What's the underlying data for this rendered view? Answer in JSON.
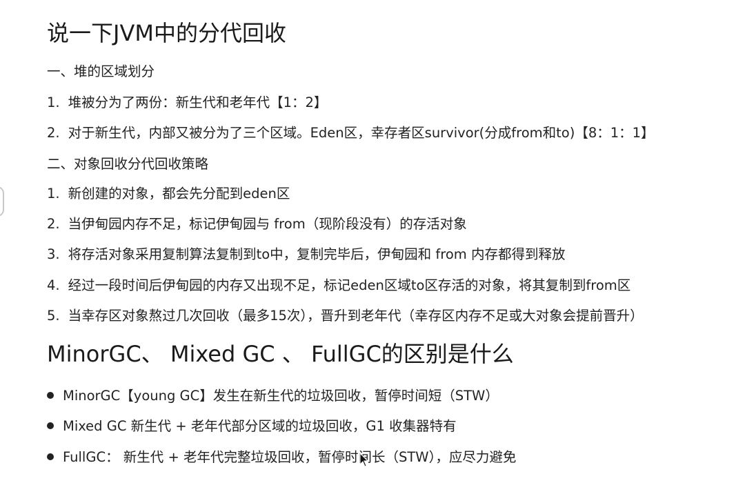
{
  "section1": {
    "title": "说一下JVM中的分代回收",
    "part1": {
      "heading": "一、堆的区域划分",
      "items": [
        {
          "num": "1.",
          "text": "堆被分为了两份：新生代和老年代【1：2】"
        },
        {
          "num": "2.",
          "text": "对于新生代，内部又被分为了三个区域。Eden区，幸存者区survivor(分成from和to)【8：1：1】"
        }
      ]
    },
    "part2": {
      "heading": "二、对象回收分代回收策略",
      "items": [
        {
          "num": "1.",
          "text": "新创建的对象，都会先分配到eden区"
        },
        {
          "num": "2.",
          "text": "当伊甸园内存不足，标记伊甸园与 from（现阶段没有）的存活对象"
        },
        {
          "num": "3.",
          "text": "将存活对象采用复制算法复制到to中，复制完毕后，伊甸园和 from 内存都得到释放"
        },
        {
          "num": "4.",
          "text": "经过一段时间后伊甸园的内存又出现不足，标记eden区域to区存活的对象，将其复制到from区"
        },
        {
          "num": "5.",
          "text": "当幸存区对象熬过几次回收（最多15次），晋升到老年代（幸存区内存不足或大对象会提前晋升）"
        }
      ]
    }
  },
  "section2": {
    "title": "MinorGC、 Mixed GC 、 FullGC的区别是什么",
    "bullets": [
      "MinorGC【young GC】发生在新生代的垃圾回收，暂停时间短（STW）",
      "Mixed GC 新生代 + 老年代部分区域的垃圾回收，G1 收集器特有",
      "FullGC：   新生代 + 老年代完整垃圾回收，暂停时间长（STW），应尽力避免"
    ]
  }
}
